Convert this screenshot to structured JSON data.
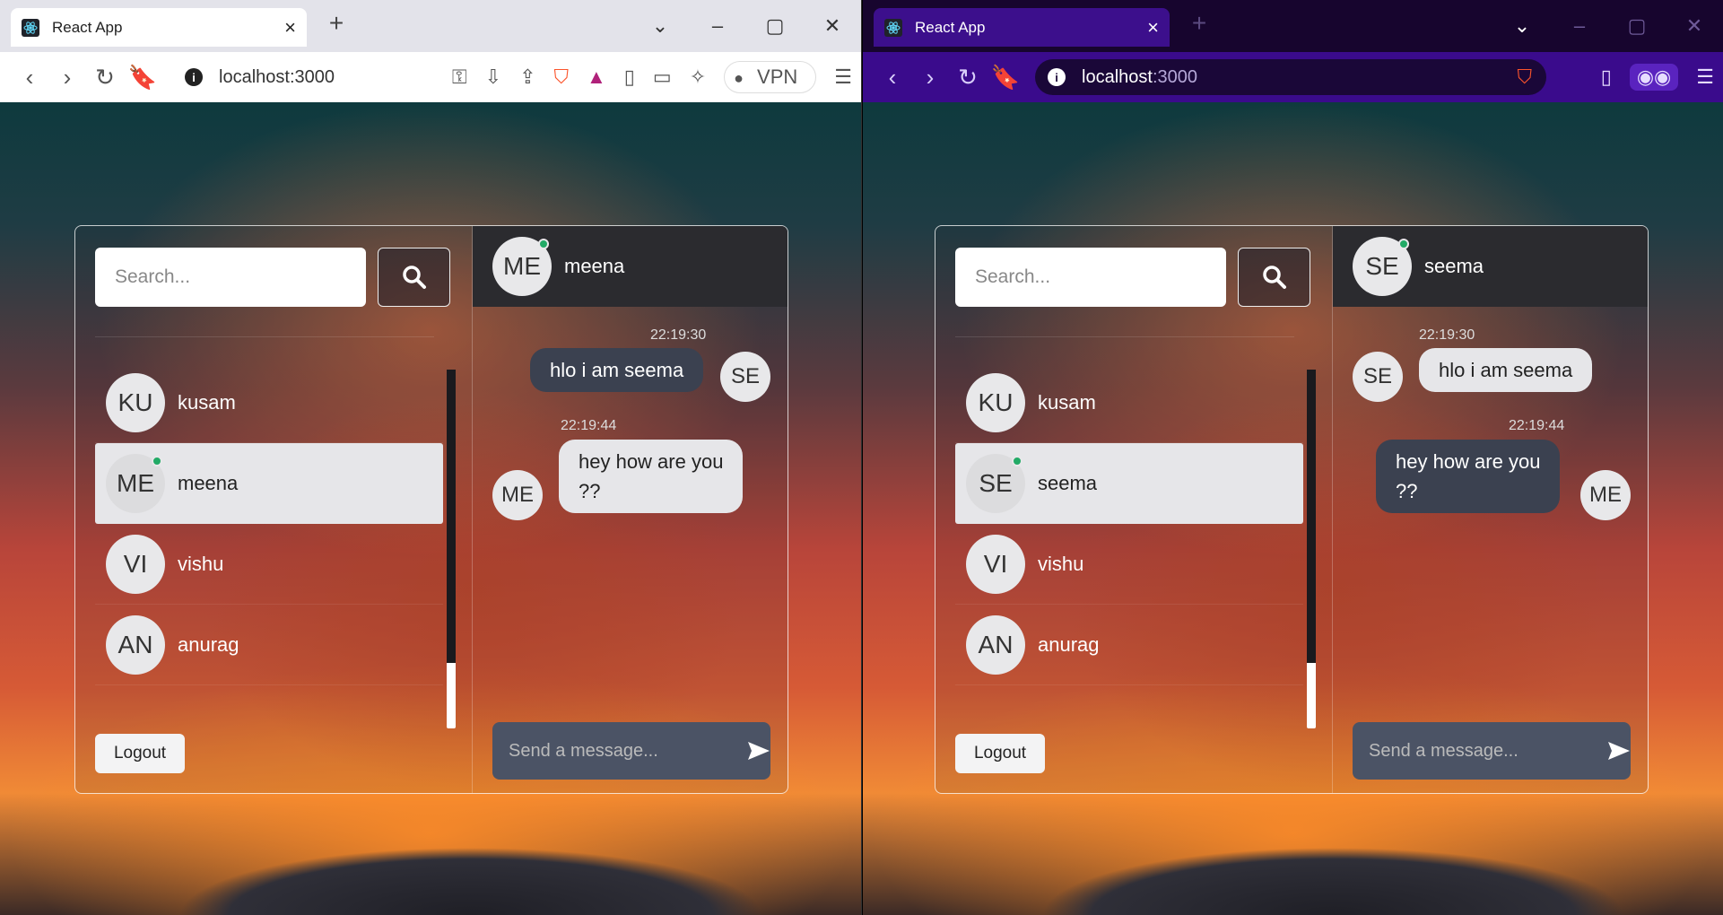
{
  "windows": [
    {
      "tab_title": "React App",
      "url_host": "localhost",
      "url_port": ":3000",
      "vpn_label": "VPN",
      "search_placeholder": "Search...",
      "contacts": [
        {
          "initials": "KU",
          "name": "kusam",
          "online": false
        },
        {
          "initials": "ME",
          "name": "meena",
          "online": true,
          "active": true
        },
        {
          "initials": "VI",
          "name": "vishu",
          "online": false
        },
        {
          "initials": "AN",
          "name": "anurag",
          "online": false
        }
      ],
      "logout_label": "Logout",
      "chat_header": {
        "initials": "ME",
        "name": "meena"
      },
      "messages": [
        {
          "time": "22:19:30",
          "text": "hlo i am seema",
          "avatar": "SE"
        },
        {
          "time": "22:19:44",
          "text_line1": "hey how are you",
          "text_line2": "??",
          "avatar": "ME"
        }
      ],
      "send_placeholder": "Send a message..."
    },
    {
      "tab_title": "React App",
      "url_host": "localhost",
      "url_port": ":3000",
      "search_placeholder": "Search...",
      "contacts": [
        {
          "initials": "KU",
          "name": "kusam",
          "online": false
        },
        {
          "initials": "SE",
          "name": "seema",
          "online": true,
          "active": true
        },
        {
          "initials": "VI",
          "name": "vishu",
          "online": false
        },
        {
          "initials": "AN",
          "name": "anurag",
          "online": false
        }
      ],
      "logout_label": "Logout",
      "chat_header": {
        "initials": "SE",
        "name": "seema"
      },
      "messages": [
        {
          "time": "22:19:30",
          "text": "hlo i am seema",
          "avatar": "SE"
        },
        {
          "time": "22:19:44",
          "text_line1": "hey how are you",
          "text_line2": "??",
          "avatar": "ME"
        }
      ],
      "send_placeholder": "Send a message..."
    }
  ],
  "colors": {
    "online": "#22aa66",
    "chat_header_bg": "#2b2b2f",
    "send_box_bg": "#4b5365",
    "brave_dark_tab": "#3c0f8c"
  }
}
